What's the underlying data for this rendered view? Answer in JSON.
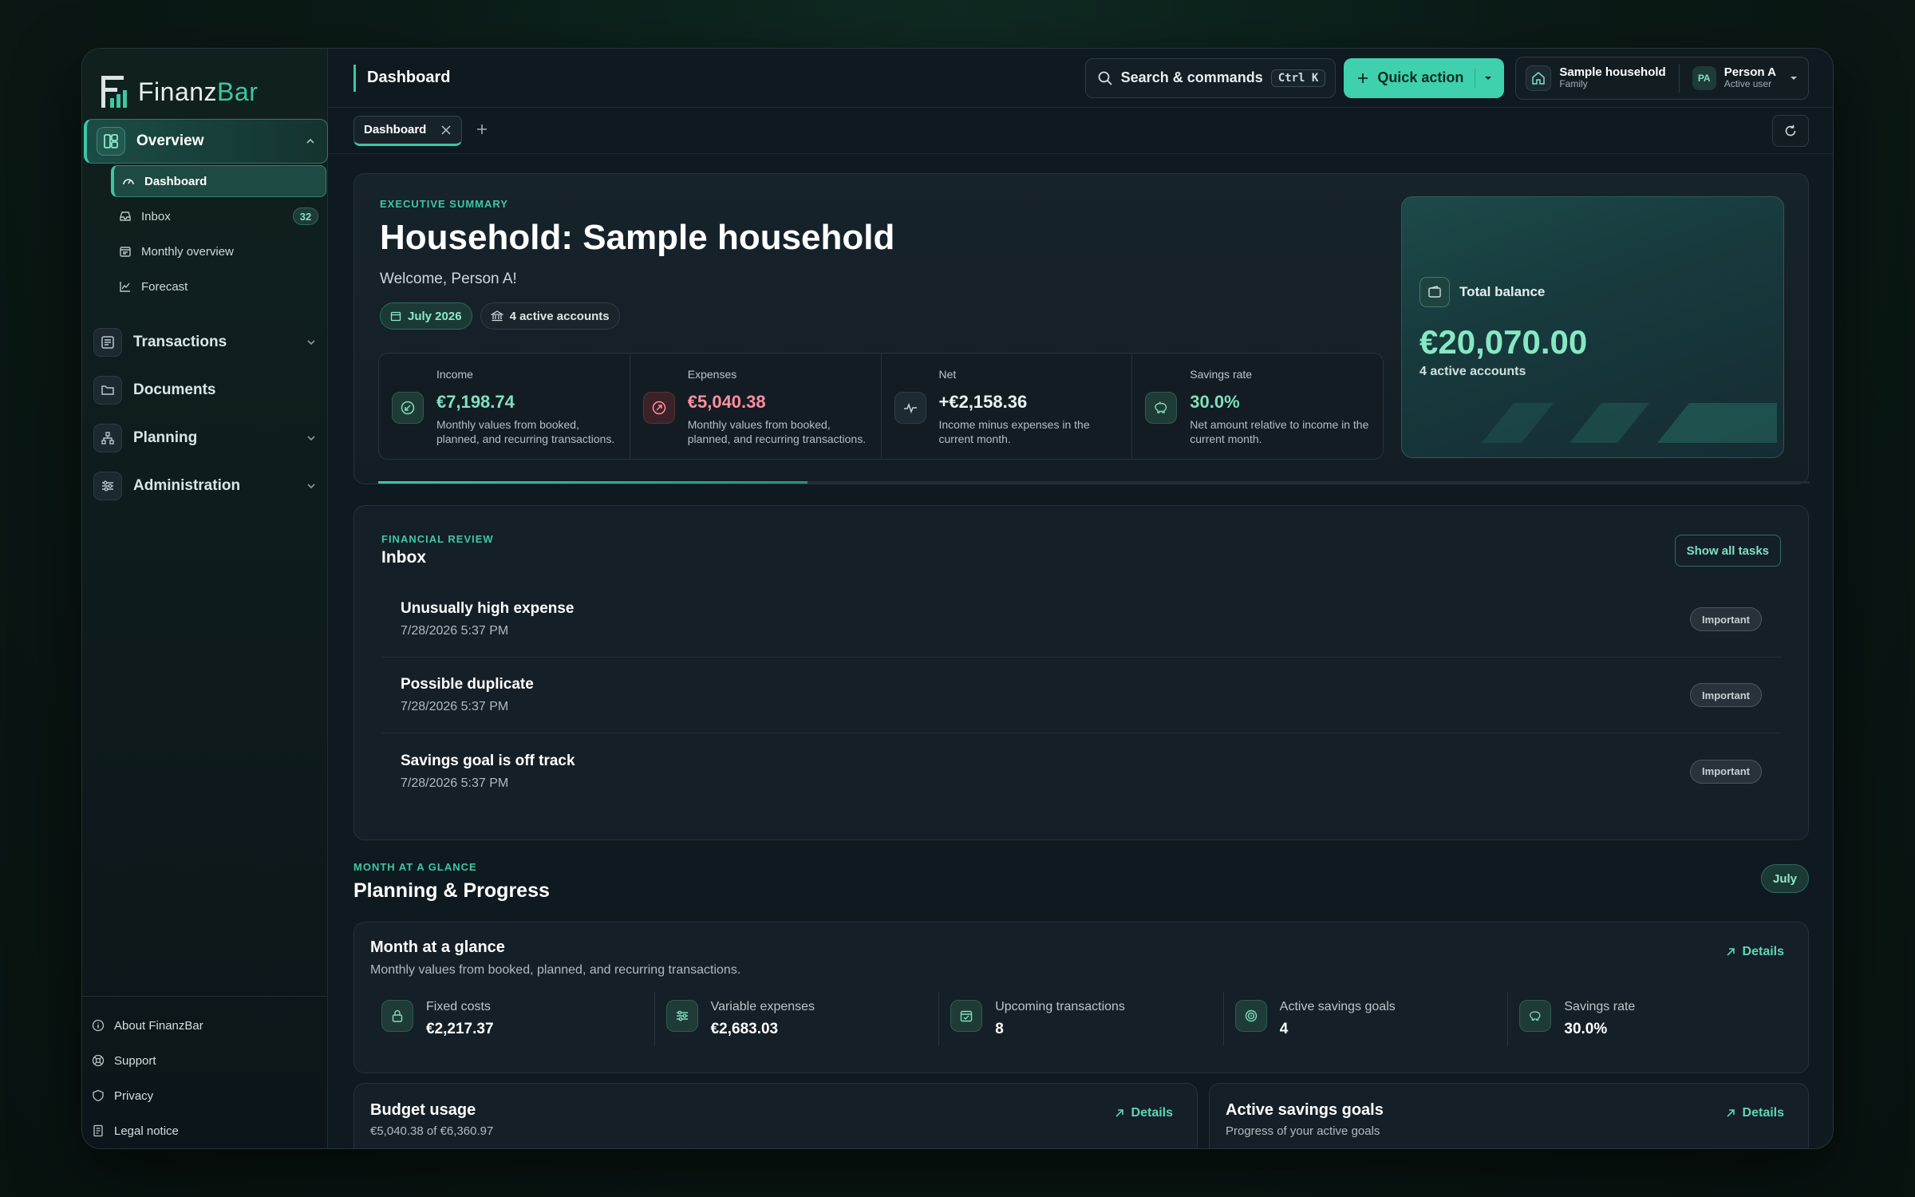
{
  "brand": {
    "name_main": "Finanz",
    "name_accent": "Bar",
    "accent_color": "#3ec7a2"
  },
  "sidebar": {
    "overview": {
      "label": "Overview",
      "icon": "layout-icon"
    },
    "sub_items": [
      {
        "label": "Dashboard",
        "icon": "gauge-icon"
      },
      {
        "label": "Inbox",
        "icon": "inbox-icon",
        "count": "32"
      },
      {
        "label": "Monthly overview",
        "icon": "calendar-icon"
      },
      {
        "label": "Forecast",
        "icon": "chart-line-icon"
      }
    ],
    "groups": [
      {
        "label": "Transactions",
        "icon": "list-icon"
      },
      {
        "label": "Documents",
        "icon": "folder-icon"
      },
      {
        "label": "Planning",
        "icon": "hierarchy-icon"
      },
      {
        "label": "Administration",
        "icon": "sliders-icon"
      }
    ],
    "footer": [
      {
        "label": "About FinanzBar",
        "icon": "info-icon"
      },
      {
        "label": "Support",
        "icon": "lifebuoy-icon"
      },
      {
        "label": "Privacy",
        "icon": "shield-icon"
      },
      {
        "label": "Legal notice",
        "icon": "document-icon"
      }
    ]
  },
  "topbar": {
    "title": "Dashboard",
    "search_label": "Search & commands",
    "shortcut": "Ctrl K",
    "quick_action": "Quick action",
    "household": {
      "name": "Sample household",
      "type": "Family"
    },
    "user": {
      "initials": "PA",
      "name": "Person A",
      "role": "Active user"
    }
  },
  "tabs": [
    {
      "label": "Dashboard"
    }
  ],
  "hero": {
    "eyebrow": "EXECUTIVE SUMMARY",
    "title": "Household: Sample household",
    "welcome": "Welcome, Person A!",
    "chip_month": "July 2026",
    "chip_accounts": "4 active accounts",
    "kpis": [
      {
        "label": "Income",
        "value": "€7,198.74",
        "desc": "Monthly values from booked, planned, and recurring transactions."
      },
      {
        "label": "Expenses",
        "value": "€5,040.38",
        "desc": "Monthly values from booked, planned, and recurring transactions."
      },
      {
        "label": "Net",
        "value": "+€2,158.36",
        "desc": "Income minus expenses in the current month."
      },
      {
        "label": "Savings rate",
        "value": "30.0%",
        "desc": "Net amount relative to income in the current month."
      }
    ],
    "progress_fraction": 0.3,
    "balance": {
      "label": "Total balance",
      "value": "€20,070.00",
      "sub": "4 active accounts"
    }
  },
  "inbox": {
    "eyebrow": "FINANCIAL REVIEW",
    "title": "Inbox",
    "show_all": "Show all tasks",
    "tasks": [
      {
        "title": "Unusually high expense",
        "date": "7/28/2026 5:37 PM",
        "badge": "Important"
      },
      {
        "title": "Possible duplicate",
        "date": "7/28/2026 5:37 PM",
        "badge": "Important"
      },
      {
        "title": "Savings goal is off track",
        "date": "7/28/2026 5:37 PM",
        "badge": "Important"
      }
    ]
  },
  "planning": {
    "eyebrow": "MONTH AT A GLANCE",
    "title": "Planning & Progress",
    "month_chip": "July",
    "glance": {
      "title": "Month at a glance",
      "subtitle": "Monthly values from booked, planned, and recurring transactions.",
      "details": "Details",
      "stats": [
        {
          "label": "Fixed costs",
          "value": "€2,217.37"
        },
        {
          "label": "Variable expenses",
          "value": "€2,683.03"
        },
        {
          "label": "Upcoming transactions",
          "value": "8"
        },
        {
          "label": "Active savings goals",
          "value": "4"
        },
        {
          "label": "Savings rate",
          "value": "30.0%"
        }
      ]
    },
    "budget": {
      "title": "Budget usage",
      "subtitle": "€5,040.38 of €6,360.97",
      "details": "Details"
    },
    "savings": {
      "title": "Active savings goals",
      "subtitle": "Progress of your active goals",
      "details": "Details"
    }
  }
}
